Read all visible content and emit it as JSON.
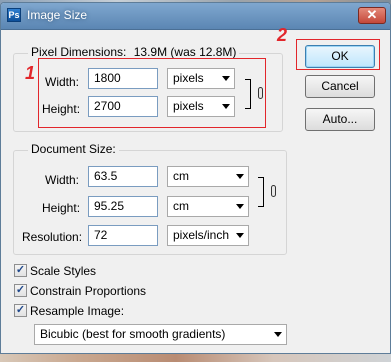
{
  "window": {
    "title": "Image Size",
    "close_label": "✕"
  },
  "pixel_dimensions": {
    "label": "Pixel Dimensions:",
    "value": "13.9M (was 12.8M)",
    "width_label": "Width:",
    "width_value": "1800",
    "width_unit": "pixels",
    "height_label": "Height:",
    "height_value": "2700",
    "height_unit": "pixels"
  },
  "document_size": {
    "label": "Document Size:",
    "width_label": "Width:",
    "width_value": "63.5",
    "width_unit": "cm",
    "height_label": "Height:",
    "height_value": "95.25",
    "height_unit": "cm",
    "resolution_label": "Resolution:",
    "resolution_value": "72",
    "resolution_unit": "pixels/inch"
  },
  "buttons": {
    "ok": "OK",
    "cancel": "Cancel",
    "auto": "Auto..."
  },
  "options": {
    "scale_styles": {
      "label": "Scale Styles",
      "checked": true
    },
    "constrain": {
      "label": "Constrain Proportions",
      "checked": true
    },
    "resample": {
      "label": "Resample Image:",
      "checked": true
    },
    "resample_method": "Bicubic (best for smooth gradients)"
  },
  "annotations": {
    "one": "1",
    "two": "2"
  },
  "colors": {
    "annotation": "#e2262b",
    "titlebar": "#5b86b3",
    "focus_border": "#7a9cc0"
  }
}
